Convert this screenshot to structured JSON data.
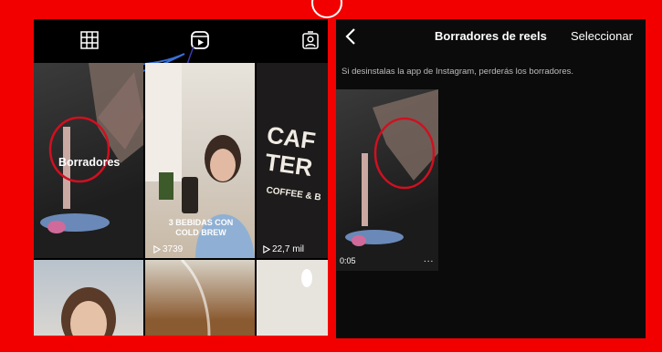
{
  "profile_tabs": {
    "grid_icon": "grid-icon",
    "reels_icon": "reels-icon",
    "tagged_icon": "tagged-icon"
  },
  "grid": {
    "items": [
      {
        "overlay": "Borradores",
        "views": ""
      },
      {
        "overlay": "3 BEBIDAS CON COLD BREW",
        "views": "3739"
      },
      {
        "overlay": "",
        "views": "22,7 mil"
      }
    ]
  },
  "drafts": {
    "back_icon": "chevron-left-icon",
    "title": "Borradores de reels",
    "select_label": "Seleccionar",
    "note": "Si desinstalas la app de Instagram, perderás los borradores.",
    "item_duration": "0:05",
    "item_more": "..."
  },
  "colors": {
    "frame": "#ff0000",
    "annotation_circle": "#d01020",
    "annotation_arrow": "#3a6fd8"
  }
}
